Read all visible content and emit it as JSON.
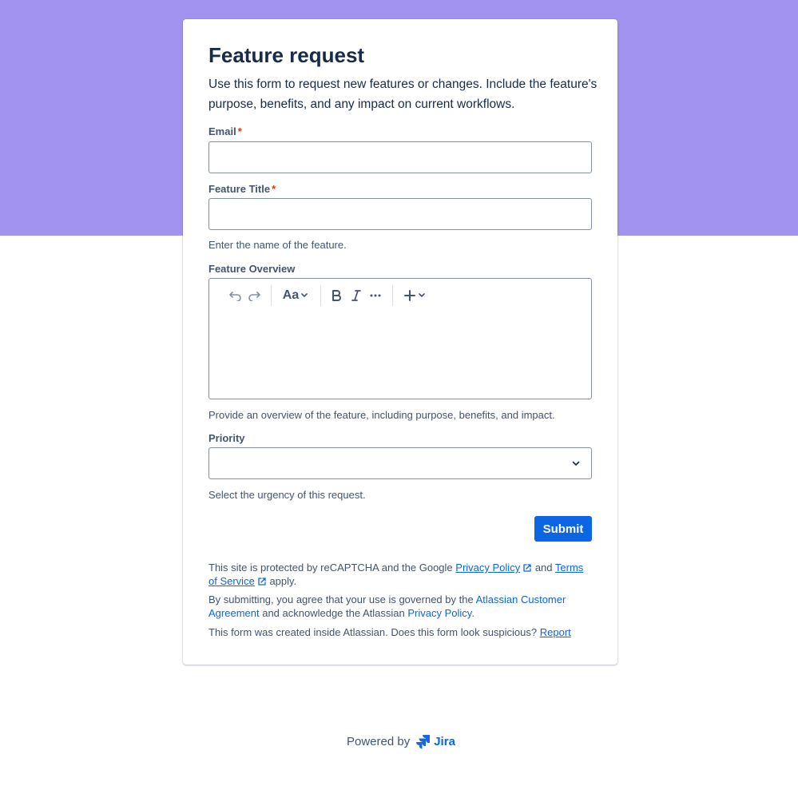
{
  "form": {
    "title": "Feature request",
    "description": "Use this form to request new features or changes. Include the feature's purpose, benefits, and any impact on current workflows.",
    "email_label": "Email",
    "required_mark": "*",
    "email_value": "",
    "feature_title_label": "Feature Title",
    "feature_title_value": "",
    "feature_title_helper": "Enter the name of the feature.",
    "overview_label": "Feature Overview",
    "overview_helper": "Provide an overview of the feature, including purpose, benefits, and impact.",
    "editor": {
      "text_style_label": "Aa"
    },
    "priority_label": "Priority",
    "priority_value": "",
    "priority_helper": "Select the urgency of this request.",
    "submit_label": "Submit"
  },
  "legal": {
    "recaptcha_prefix": "This site is protected by reCAPTCHA and the Google",
    "privacy_policy": "Privacy Policy",
    "and": "and",
    "terms_of_service": "Terms of Service",
    "apply": "apply.",
    "agreement_prefix": "By submitting, you agree that your use is governed by the",
    "atlassian_customer_agreement": "Atlassian Customer Agreement",
    "agreement_middle": "and acknowledge the Atlassian",
    "atlassian_privacy_policy": "Privacy Policy",
    "period": ".",
    "created_inside": "This form was created inside Atlassian. Does this form look suspicious?",
    "report": "Report"
  },
  "footer": {
    "powered_by": "Powered by",
    "brand": "Jira"
  },
  "colors": {
    "banner": "#a293f0",
    "primary": "#0c66e4",
    "required": "#de350b"
  }
}
